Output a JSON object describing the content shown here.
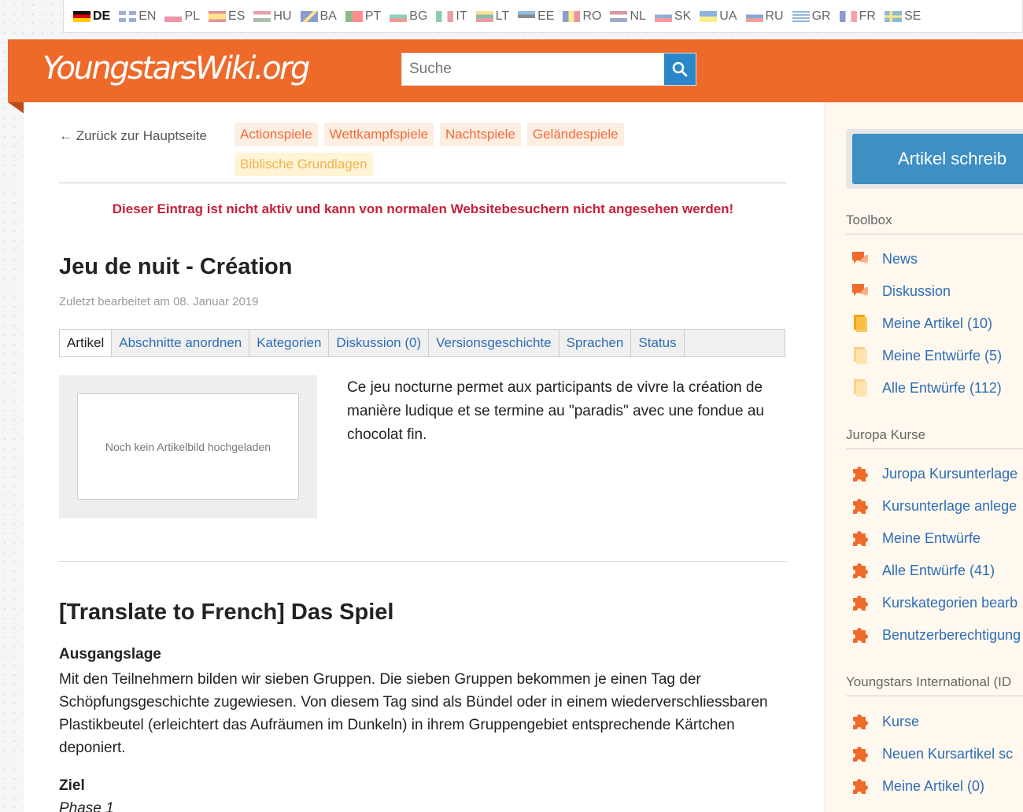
{
  "languages": [
    {
      "code": "DE",
      "active": true
    },
    {
      "code": "EN"
    },
    {
      "code": "PL"
    },
    {
      "code": "ES"
    },
    {
      "code": "HU"
    },
    {
      "code": "BA"
    },
    {
      "code": "PT"
    },
    {
      "code": "BG"
    },
    {
      "code": "IT"
    },
    {
      "code": "LT"
    },
    {
      "code": "EE"
    },
    {
      "code": "RO"
    },
    {
      "code": "NL"
    },
    {
      "code": "SK"
    },
    {
      "code": "UA"
    },
    {
      "code": "RU"
    },
    {
      "code": "GR"
    },
    {
      "code": "FR"
    },
    {
      "code": "SE"
    }
  ],
  "header": {
    "logo": "YoungstarsWiki.org",
    "search_placeholder": "Suche"
  },
  "nav": {
    "back": "← Zurück zur Hauptseite",
    "categories": [
      "Actionspiele",
      "Wettkampfspiele",
      "Nachtspiele",
      "Geländespiele",
      "Biblische Grundlagen"
    ]
  },
  "article": {
    "warning": "Dieser Eintrag ist nicht aktiv und kann von normalen Websitebesuchern nicht angesehen werden!",
    "title": "Jeu de nuit - Création",
    "last_edited": "Zuletzt bearbeitet am 08. Januar 2019",
    "tabs": [
      "Artikel",
      "Abschnitte anordnen",
      "Kategorien",
      "Diskussion (0)",
      "Versionsgeschichte",
      "Sprachen",
      "Status"
    ],
    "no_image": "Noch kein Artikelbild hochgeladen",
    "intro": "Ce jeu nocturne permet aux participants de vivre la création de manière ludique et se termine au \"paradis\" avec une fondue au chocolat fin.",
    "section_title": "[Translate to French] Das Spiel",
    "sub1": "Ausgangslage",
    "para1": "Mit den Teilnehmern bilden wir sieben Gruppen. Die sieben Gruppen bekommen je einen Tag der Schöpfungsgeschichte zugewiesen. Von diesem Tag sind als Bündel oder in einem wiederverschliessbaren Plastikbeutel (erleichtert das Aufräumen im Dunkeln) in ihrem Gruppengebiet entsprechende Kärtchen deponiert.",
    "sub2": "Ziel",
    "phase": "Phase 1"
  },
  "sidebar": {
    "write_button": "Artikel schreib",
    "toolbox_title": "Toolbox",
    "toolbox": [
      {
        "label": "News",
        "icon": "speech-bubble-icon"
      },
      {
        "label": "Diskussion",
        "icon": "speech-bubble-icon"
      },
      {
        "label": "Meine Artikel (10)",
        "icon": "document-icon"
      },
      {
        "label": "Meine Entwürfe (5)",
        "icon": "draft-document-icon"
      },
      {
        "label": "Alle Entwürfe (112)",
        "icon": "draft-document-icon"
      }
    ],
    "juropa_title": "Juropa Kurse",
    "juropa": [
      "Juropa Kursunterlage",
      "Kursunterlage anlege",
      "Meine Entwürfe",
      "Alle Entwürfe (41)",
      "Kurskategorien bearb",
      "Benutzerberechtigung"
    ],
    "intl_title": "Youngstars International (ID",
    "intl": [
      "Kurse",
      "Neuen Kursartikel sc",
      "Meine Artikel (0)"
    ]
  },
  "colors": {
    "header": "#ee6a2b",
    "link": "#2d6db4",
    "warning": "#c8203a",
    "button": "#3d8fc4"
  }
}
